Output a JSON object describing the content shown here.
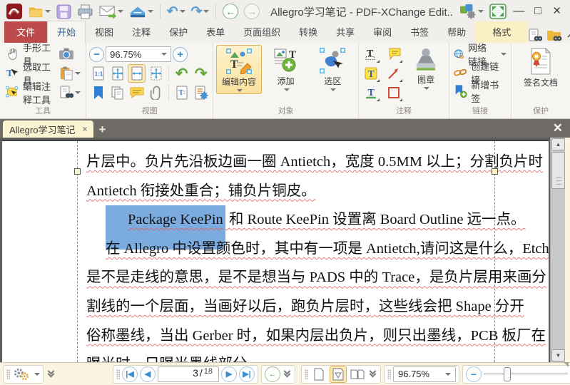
{
  "window": {
    "title": "Allegro学习笔记 - PDF-XChange Edit.."
  },
  "tabs": {
    "file": "文件",
    "home": "开始",
    "view": "视图",
    "comment": "注释",
    "protect": "保护",
    "form": "表单",
    "organize": "页面组织",
    "convert": "转换",
    "share": "共享",
    "review": "审阅",
    "bookmarks": "书签",
    "help": "帮助",
    "format": "格式"
  },
  "ribbon": {
    "tools": {
      "label": "工具",
      "hand": "手形工具",
      "select": "选取工具",
      "edit_annot": "编辑注释工具"
    },
    "view": {
      "label": "视图",
      "zoom": "96.75%"
    },
    "object": {
      "label": "对象",
      "edit_content": "编辑内容",
      "add": "添加",
      "selection": "选区"
    },
    "comment": {
      "label": "注释",
      "stamp": "图章"
    },
    "links": {
      "label": "链接",
      "web": "网络链接",
      "create": "创建链接",
      "bookmark": "新增书签"
    },
    "protect": {
      "label": "保护",
      "sign": "签名文档"
    }
  },
  "doctab": {
    "title": "Allegro学习笔记"
  },
  "doc": {
    "l1": "片层中。负片先沿板边画一圈 Antietch，宽度 0.5MM 以上；分割负片时",
    "l2": "Antietch 衔接处重合；铺负片铜皮。",
    "l3_hl": "Package KeePin",
    "l3_rest": " 和 Route KeePin 设置离 Board Outline 远一点。",
    "l4": "在 Allegro 中设置颜色时，其中有一项是 Antietch,请问这是什么，Etch",
    "l5": "是不是走线的意思，是不是想当与 PADS 中的 Trace，是负片层用来画分",
    "l6": "割线的一个层面，当画好以后，跑负片层时，这些线会把 Shape 分开",
    "l7": "俗称墨线，当出 Gerber 时，如果内层出负片，则只出墨线，PCB 板厂在",
    "l8": "曝光时，只曝光墨线部分。"
  },
  "status": {
    "page": "3",
    "sep": "/",
    "total": "18",
    "zoom": "96.75%"
  }
}
